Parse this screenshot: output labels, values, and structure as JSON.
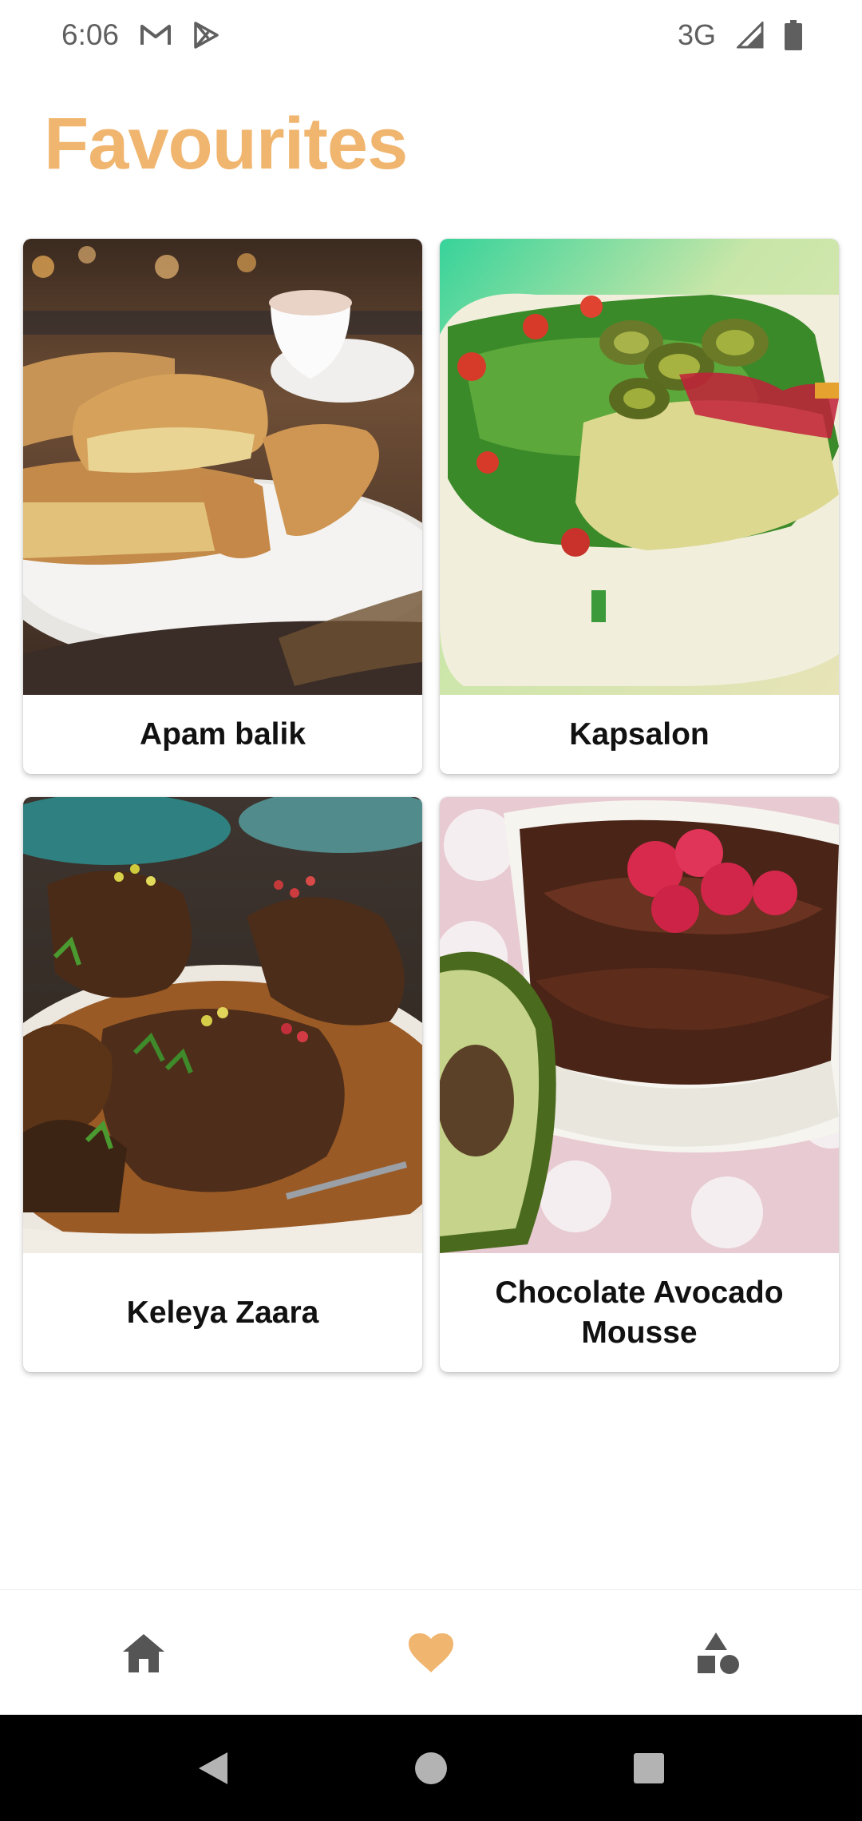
{
  "status_bar": {
    "time": "6:06",
    "network": "3G",
    "notification_icons": [
      "gmail-icon",
      "play-store-icon"
    ],
    "system_icons": [
      "signal-icon",
      "battery-icon"
    ]
  },
  "page": {
    "title": "Favourites",
    "accent_color": "#f0b56e"
  },
  "favourites": [
    {
      "name": "Apam balik",
      "image": "apam-balik-photo"
    },
    {
      "name": "Kapsalon",
      "image": "kapsalon-photo"
    },
    {
      "name": "Keleya Zaara",
      "image": "keleya-zaara-photo"
    },
    {
      "name": "Chocolate Avocado Mousse",
      "image": "chocolate-avocado-mousse-photo"
    }
  ],
  "bottom_nav": {
    "items": [
      {
        "icon": "home-icon",
        "active": false
      },
      {
        "icon": "heart-icon",
        "active": true
      },
      {
        "icon": "categories-icon",
        "active": false
      }
    ],
    "active_color": "#f0b56e",
    "inactive_color": "#555555"
  },
  "system_nav": {
    "buttons": [
      "back-icon",
      "home-circle-icon",
      "recents-icon"
    ]
  }
}
